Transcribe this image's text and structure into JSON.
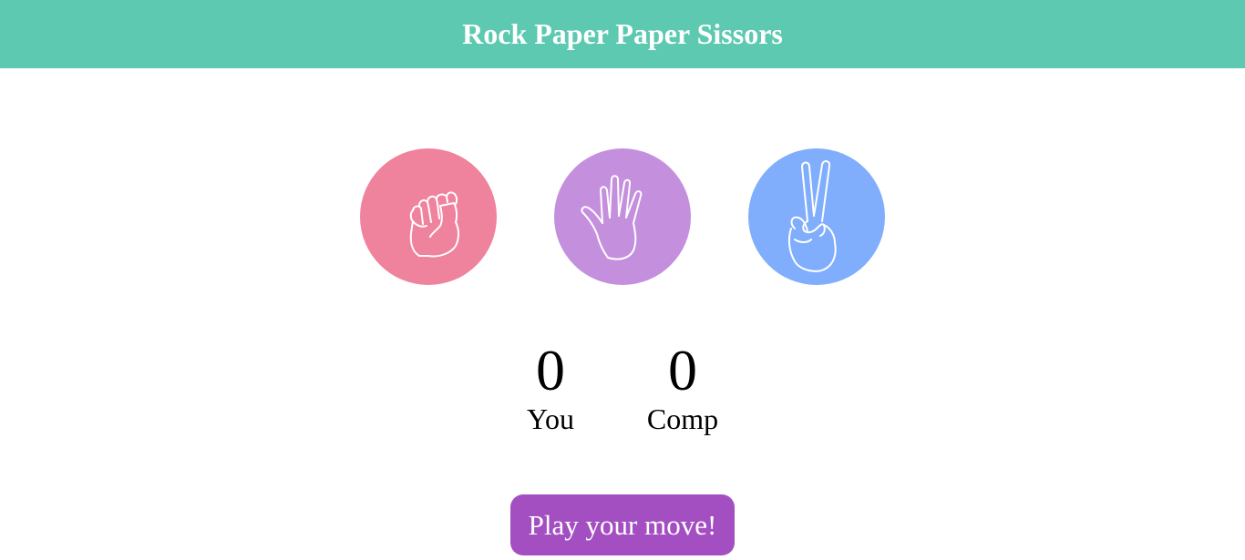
{
  "header": {
    "title": "Rock Paper Paper Sissors",
    "background_color": "#5cc9b0"
  },
  "choices": [
    {
      "name": "rock",
      "icon": "fist-icon",
      "color": "#ef829d"
    },
    {
      "name": "paper",
      "icon": "open-hand-icon",
      "color": "#c490dd"
    },
    {
      "name": "scissors",
      "icon": "peace-sign-icon",
      "color": "#80aefc"
    }
  ],
  "scores": {
    "you": {
      "value": "0",
      "label": "You"
    },
    "comp": {
      "value": "0",
      "label": "Comp"
    }
  },
  "play_button": {
    "label": "Play your move!",
    "color": "#a34fc2"
  }
}
